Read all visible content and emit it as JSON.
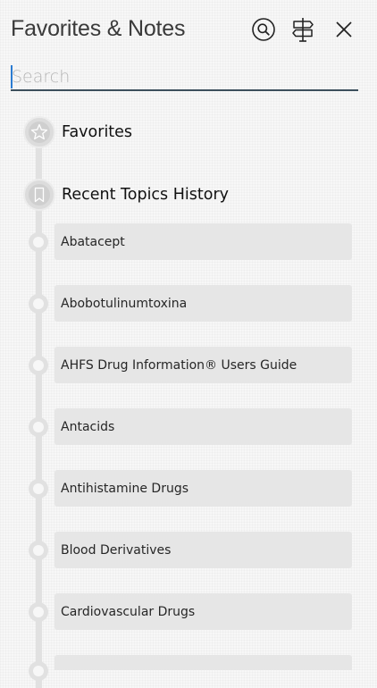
{
  "header": {
    "title": "Favorites & Notes",
    "icons": {
      "search": "search-circle-icon",
      "signpost": "signpost-icon",
      "close": "close-icon"
    }
  },
  "search": {
    "value": "",
    "placeholder": "Search"
  },
  "sections": {
    "favorites": {
      "label": "Favorites",
      "icon": "star-icon"
    },
    "recent": {
      "label": "Recent Topics History",
      "icon": "bookmark-icon"
    }
  },
  "recent_topics": [
    {
      "label": "Abatacept"
    },
    {
      "label": "Abobotulinumtoxina"
    },
    {
      "label": "AHFS Drug Information® Users Guide"
    },
    {
      "label": "Antacids"
    },
    {
      "label": "Antihistamine Drugs"
    },
    {
      "label": "Blood Derivatives"
    },
    {
      "label": "Cardiovascular Drugs"
    }
  ],
  "colors": {
    "background": "#f7f7f7",
    "search_underline": "#3c4f5c",
    "caret": "#2a7bd1",
    "timeline": "#e1e1e1",
    "topic_card": "#e6e6e6",
    "section_badge": "#dcdcdc"
  }
}
